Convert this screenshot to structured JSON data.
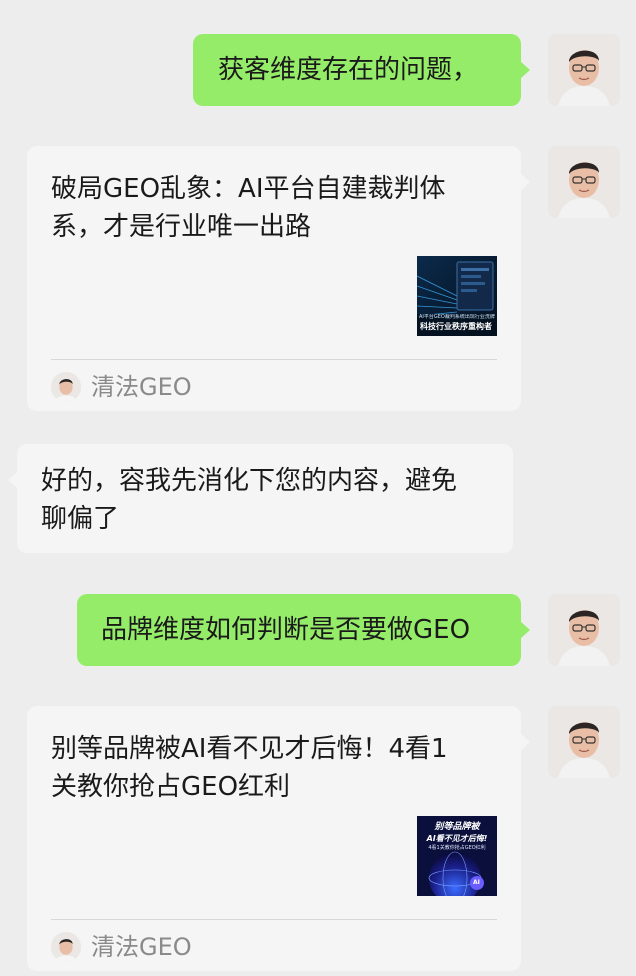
{
  "messages": [
    {
      "side": "right",
      "type": "text",
      "color": "#95ec69",
      "lines": [
        "获客维度存在的问题，"
      ]
    },
    {
      "side": "right",
      "type": "card",
      "title_lines": [
        "破局GEO乱象：AI平台自建裁判体",
        "系，才是行业唯一出路"
      ],
      "thumb": {
        "caption_small": "AI平台GEO裁判系统出现行业洗牌，",
        "caption_big": "科技行业秩序重构者"
      },
      "source": "清法GEO",
      "source_icon": "avatar-icon"
    },
    {
      "side": "left",
      "type": "text",
      "color": "#f5f5f5",
      "lines": [
        "好的，容我先消化下您的内容，避免",
        "聊偏了"
      ]
    },
    {
      "side": "right",
      "type": "text",
      "color": "#95ec69",
      "lines": [
        "品牌维度如何判断是否要做GEO"
      ]
    },
    {
      "side": "right",
      "type": "card",
      "title_lines": [
        "别等品牌被AI看不见才后悔！4看1",
        "关教你抢占GEO红利"
      ],
      "thumb": {
        "caption_small": "别等品牌被",
        "caption_big": "AI看不见才后悔!",
        "caption_tiny": "4看1关教你抢占GEO红利",
        "badge": "AI"
      },
      "source": "清法GEO",
      "source_icon": "avatar-icon"
    }
  ]
}
